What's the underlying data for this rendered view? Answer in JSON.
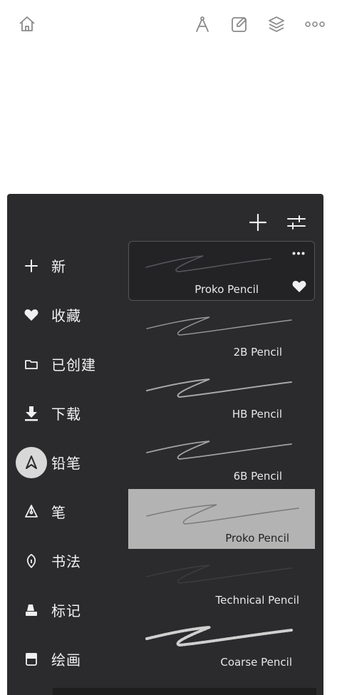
{
  "toolbar": {
    "icons": [
      "home-icon",
      "ruler-compass-icon",
      "edit-square-icon",
      "layers-icon",
      "more-horizontal-icon"
    ]
  },
  "panel": {
    "add_icon": "plus-icon",
    "settings_icon": "sliders-icon"
  },
  "categories": [
    {
      "label": "新",
      "icon": "plus-icon"
    },
    {
      "label": "收藏",
      "icon": "heart-icon"
    },
    {
      "label": "已创建",
      "icon": "folder-icon"
    },
    {
      "label": "下载",
      "icon": "download-icon"
    },
    {
      "label": "铅笔",
      "icon": "pencil-tip-icon",
      "active": true
    },
    {
      "label": "笔",
      "icon": "pen-nib-icon"
    },
    {
      "label": "书法",
      "icon": "calligraphy-nib-icon"
    },
    {
      "label": "标记",
      "icon": "marker-icon"
    },
    {
      "label": "绘画",
      "icon": "paint-icon"
    }
  ],
  "brushes": [
    {
      "name": "Proko Pencil",
      "state": "selected",
      "favorited": true,
      "stroke_color": "#555558"
    },
    {
      "name": "2B Pencil",
      "state": "normal",
      "stroke_color": "#9a9a9c"
    },
    {
      "name": "HB Pencil",
      "state": "normal",
      "stroke_color": "#a8a8aa"
    },
    {
      "name": "6B Pencil",
      "state": "normal",
      "stroke_color": "#a0a0a2"
    },
    {
      "name": "Proko Pencil",
      "state": "highlight",
      "stroke_color": "#7a7a7c"
    },
    {
      "name": "Technical Pencil",
      "state": "normal",
      "stroke_color": "#3e3e40"
    },
    {
      "name": "Coarse Pencil",
      "state": "normal",
      "stroke_color": "#d0d0d0"
    }
  ],
  "colors": {
    "panel_bg": "#2b2b2d",
    "highlight_bg": "#b3b3b3",
    "text": "#f2f2f2"
  }
}
